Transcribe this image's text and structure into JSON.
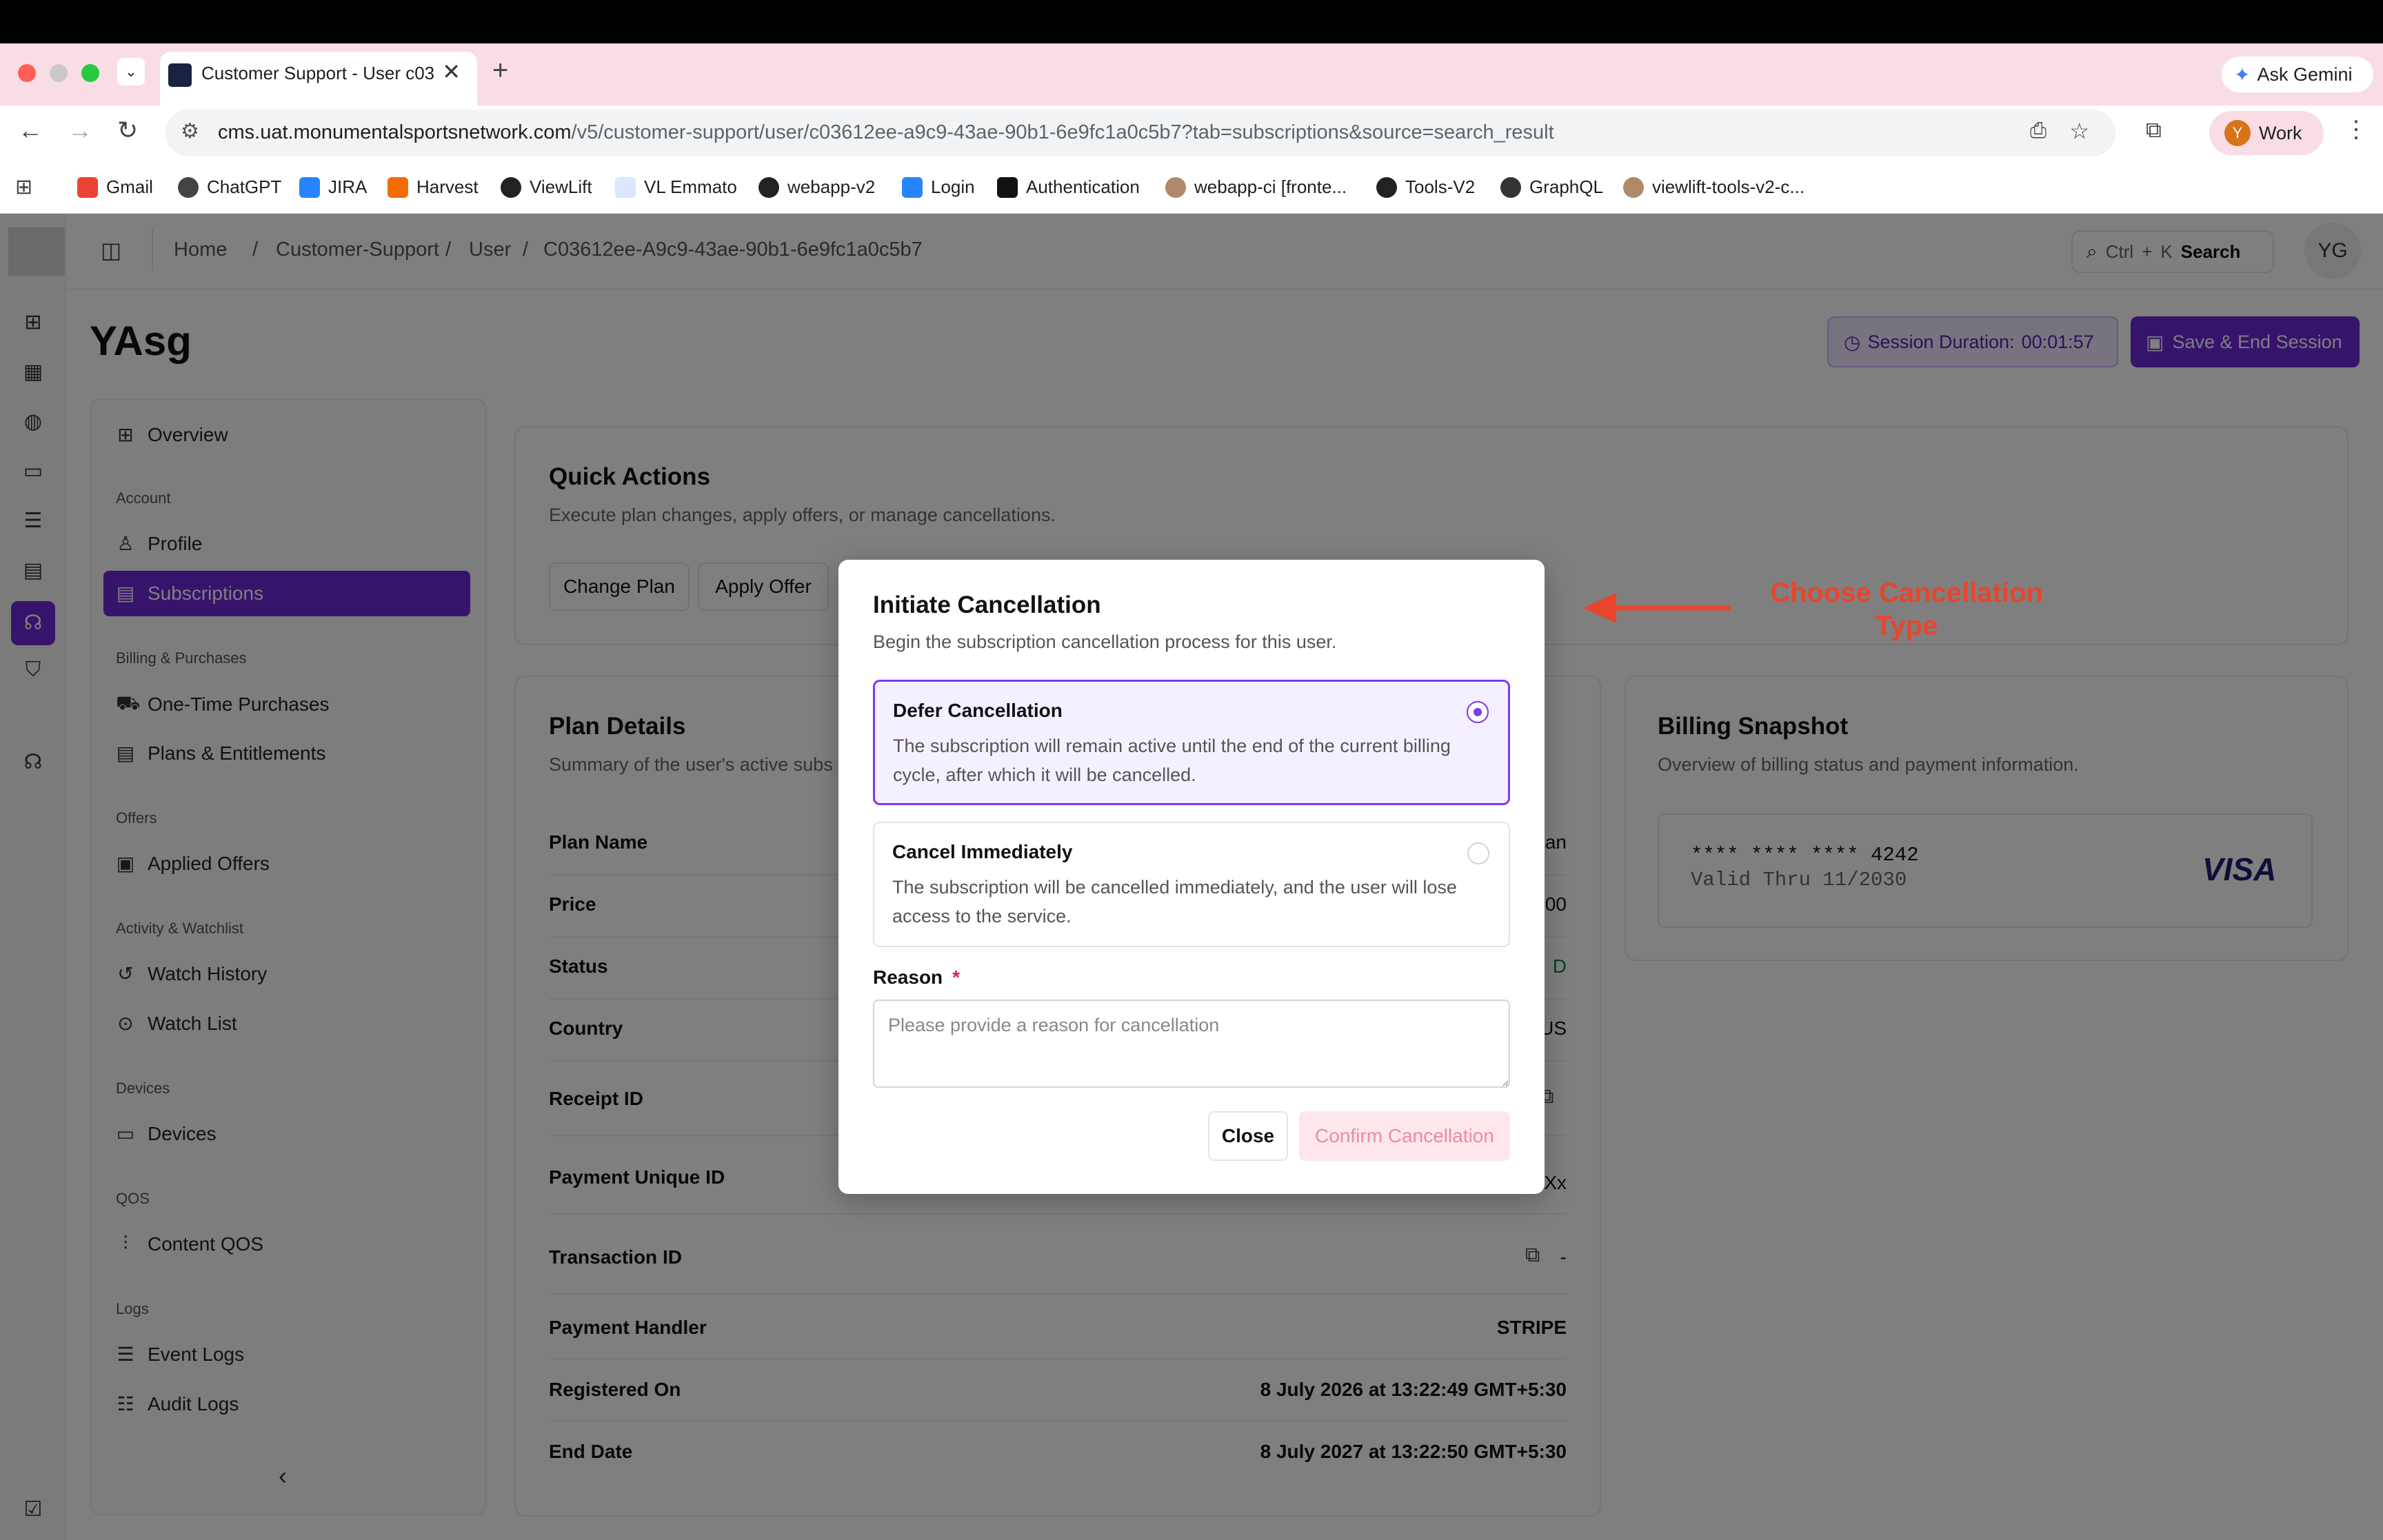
{
  "browser": {
    "tab_title": "Customer Support - User c03",
    "new_tab": "+",
    "close_tab": "✕",
    "ask_gemini": "Ask Gemini",
    "url_host": "cms.uat.monumentalsportsnetwork.com",
    "url_path": "/v5/customer-support/user/c03612ee-a9c9-43ae-90b1-6e9fc1a0c5b7?tab=subscriptions&source=search_result",
    "profile_initial": "Y",
    "profile_label": "Work",
    "bookmarks": [
      "Gmail",
      "ChatGPT",
      "JIRA",
      "Harvest",
      "ViewLift",
      "VL Emmato",
      "webapp-v2",
      "Login",
      "Authentication",
      "webapp-ci [fronte...",
      "Tools-V2",
      "GraphQL",
      "viewlift-tools-v2-c..."
    ]
  },
  "header": {
    "breadcrumbs": [
      "Home",
      "/",
      "Customer-Support",
      "/",
      "User",
      "/",
      "C03612ee-A9c9-43ae-90b1-6e9fc1a0c5b7"
    ],
    "search_shortcut_ctrl": "Ctrl",
    "search_shortcut_plus": "+",
    "search_shortcut_k": "K",
    "search_label": "Search",
    "user_initials": "YG"
  },
  "page": {
    "title": "YAsg",
    "session_label": "Session Duration:",
    "session_time": "00:01:57",
    "save_end_label": "Save & End Session"
  },
  "sidebar": {
    "overview": "Overview",
    "groups": {
      "account": "Account",
      "billing": "Billing & Purchases",
      "offers": "Offers",
      "activity": "Activity & Watchlist",
      "devices": "Devices",
      "qos": "QOS",
      "logs": "Logs"
    },
    "items": {
      "profile": "Profile",
      "subscriptions": "Subscriptions",
      "one_time": "One-Time Purchases",
      "plans": "Plans & Entitlements",
      "applied_offers": "Applied Offers",
      "watch_history": "Watch History",
      "watch_list": "Watch List",
      "devices": "Devices",
      "content_qos": "Content QOS",
      "event_logs": "Event Logs",
      "audit_logs": "Audit Logs"
    },
    "collapse": "‹"
  },
  "quick_actions": {
    "title": "Quick Actions",
    "subtitle": "Execute plan changes, apply offers, or manage cancellations.",
    "change_plan": "Change Plan",
    "apply_offer": "Apply Offer"
  },
  "plan_details": {
    "title": "Plan Details",
    "subtitle": "Summary of the user's active subs",
    "rows": [
      {
        "label": "Plan Name",
        "value": "an"
      },
      {
        "label": "Price",
        "value": "00"
      },
      {
        "label": "Status",
        "value": "D"
      },
      {
        "label": "Country",
        "value": "US"
      },
      {
        "label": "Receipt ID",
        "value": ""
      },
      {
        "label": "Payment Unique ID",
        "value": "Xx"
      },
      {
        "label": "Transaction ID",
        "value": "-"
      },
      {
        "label": "Payment Handler",
        "value": "STRIPE"
      },
      {
        "label": "Registered On",
        "value": "8 July 2026 at 13:22:49 GMT+5:30"
      },
      {
        "label": "End Date",
        "value": "8 July 2027 at 13:22:50 GMT+5:30"
      }
    ]
  },
  "billing": {
    "title": "Billing Snapshot",
    "subtitle": "Overview of billing status and payment information.",
    "card_number": "**** **** **** 4242",
    "valid_thru": "Valid Thru 11/2030",
    "brand": "VISA"
  },
  "dialog": {
    "title": "Initiate Cancellation",
    "subtitle": "Begin the subscription cancellation process for this user.",
    "option_defer_title": "Defer Cancellation",
    "option_defer_desc": "The subscription will remain active until the end of the current billing cycle, after which it will be cancelled.",
    "option_immediate_title": "Cancel Immediately",
    "option_immediate_desc": "The subscription will be cancelled immediately, and the user will lose access to the service.",
    "reason_label": "Reason",
    "reason_required": "*",
    "reason_placeholder": "Please provide a reason for cancellation",
    "reason_value": "",
    "close_label": "Close",
    "confirm_label": "Confirm Cancellation"
  },
  "annotation": {
    "text_line1": "Choose Cancellation",
    "text_line2": "Type",
    "color": "#e8452c"
  },
  "colors": {
    "accent": "#6d28d9",
    "tabstrip": "#f9dde4"
  }
}
